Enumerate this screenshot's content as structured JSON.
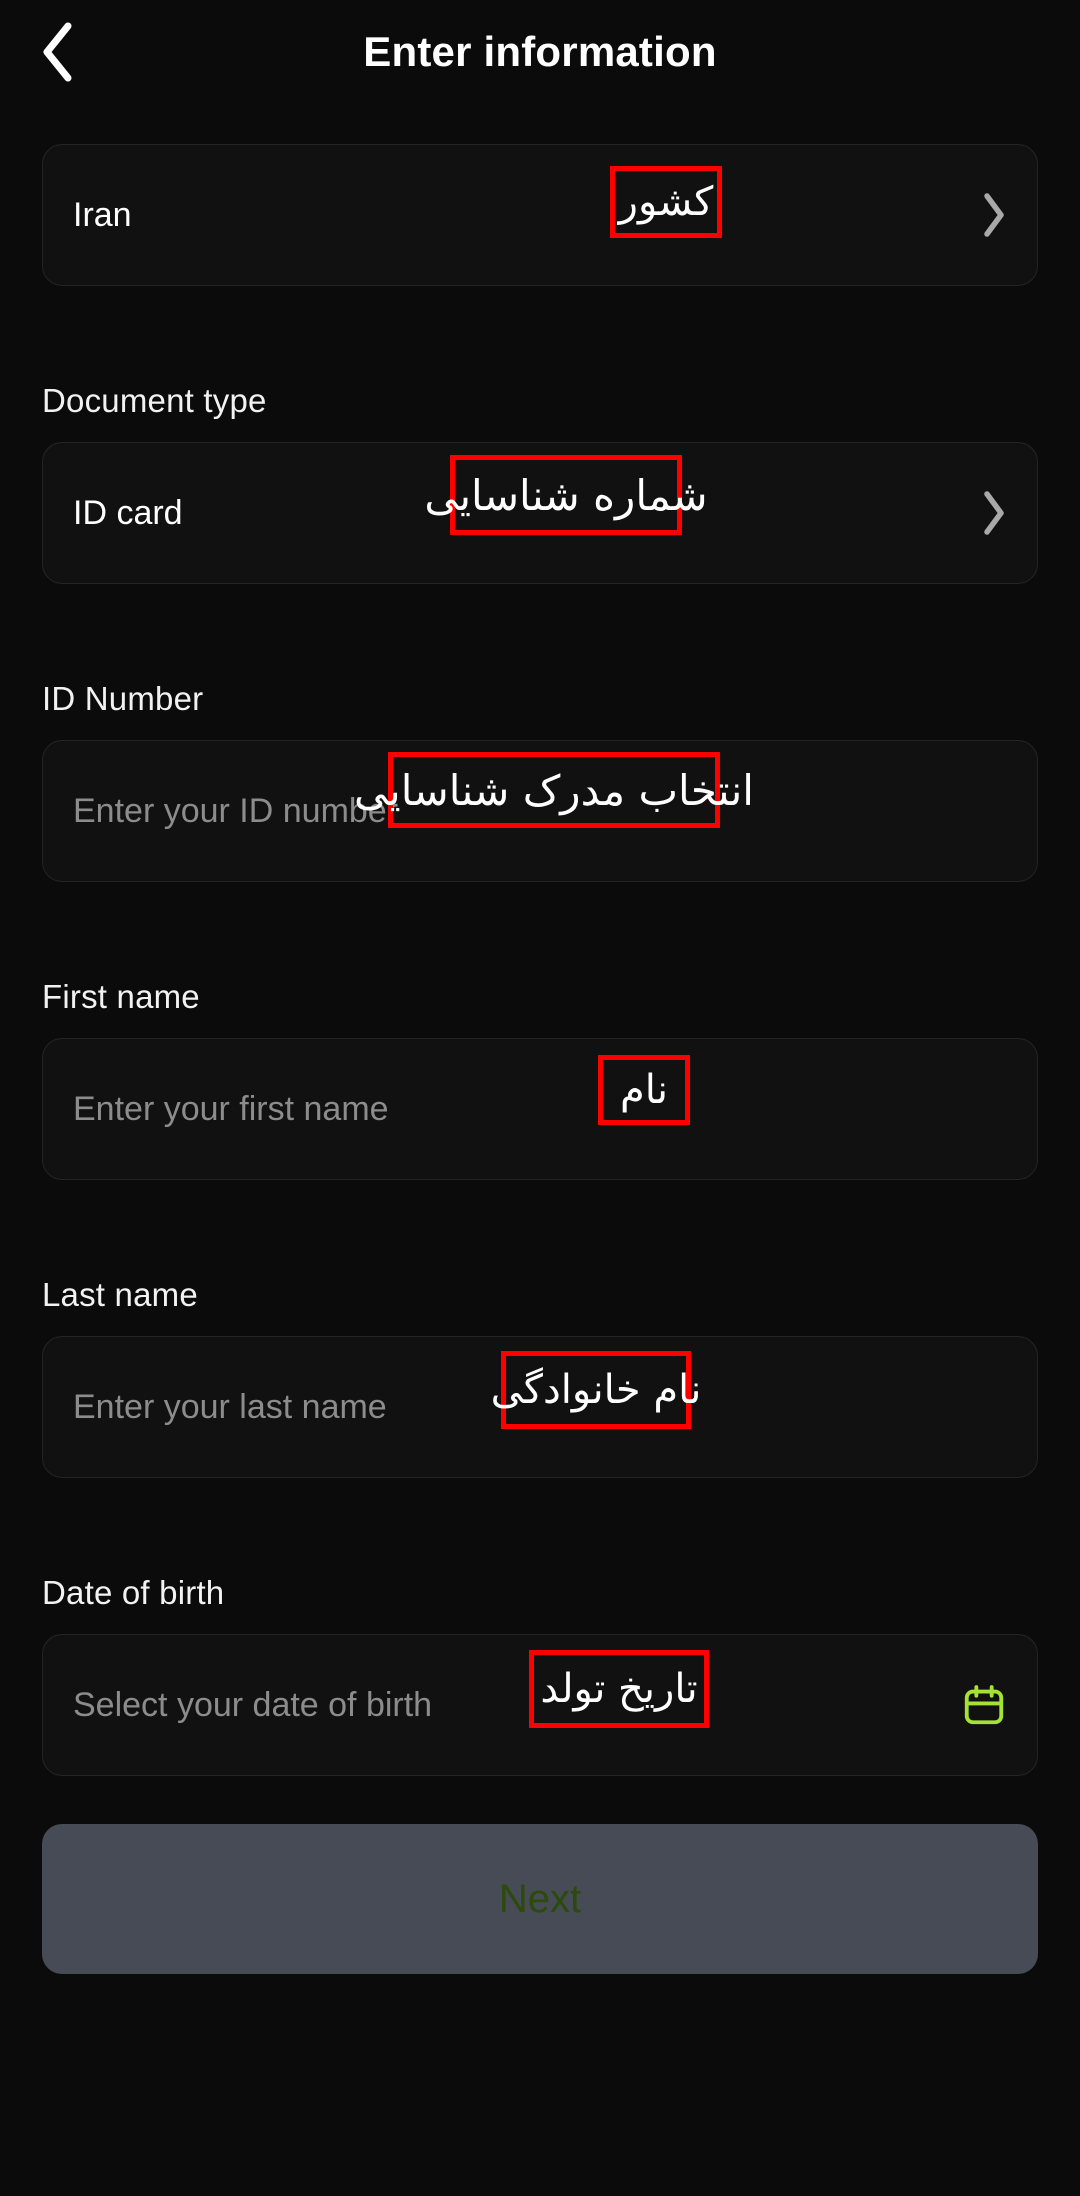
{
  "header": {
    "title": "Enter information",
    "back_icon": "chevron-left-icon"
  },
  "colors": {
    "background": "#0b0b0b",
    "field_bg": "#111111",
    "field_border": "#242424",
    "text_primary": "#ffffff",
    "text_placeholder": "#8c8c8c",
    "annotation_border": "#ff0000",
    "calendar_icon": "#a6e234",
    "next_button_bg": "#474b56",
    "next_button_text": "#2b4a0c"
  },
  "form": {
    "country": {
      "label": "",
      "value": "Iran",
      "chevron_icon": "chevron-right-icon",
      "annotation": "کشور"
    },
    "document_type": {
      "label": "Document type",
      "value": "ID card",
      "chevron_icon": "chevron-right-icon",
      "annotation": "شماره شناسایی"
    },
    "id_number": {
      "label": "ID Number",
      "placeholder": "Enter your ID number",
      "value": "",
      "annotation": "انتخاب مدرک شناسایی"
    },
    "first_name": {
      "label": "First name",
      "placeholder": "Enter your first name",
      "value": "",
      "annotation": "نام"
    },
    "last_name": {
      "label": "Last name",
      "placeholder": "Enter your last name",
      "value": "",
      "annotation": "نام خانوادگی"
    },
    "date_of_birth": {
      "label": "Date of birth",
      "placeholder": "Select your date of birth",
      "value": "",
      "calendar_icon": "calendar-icon",
      "annotation": "تاریخ تولد"
    }
  },
  "footer": {
    "next_label": "Next"
  }
}
